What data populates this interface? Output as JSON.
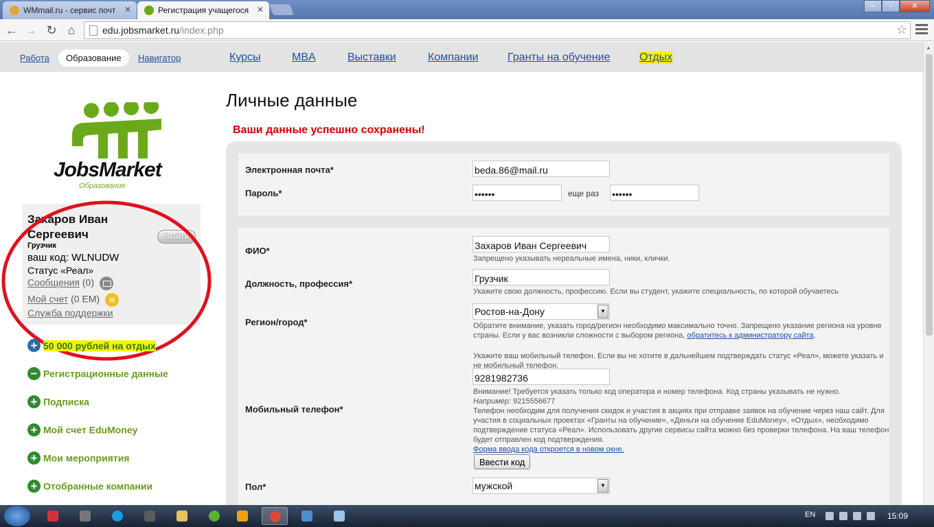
{
  "browser": {
    "tabs": [
      {
        "title": "WMmail.ru - сервис почт",
        "active": false,
        "favicon": "wmmail-icon"
      },
      {
        "title": "Регистрация учащегося",
        "active": true,
        "favicon": "jobsmarket-icon"
      }
    ],
    "url_host": "edu.jobsmarket.ru",
    "url_path": "/index.php"
  },
  "topnav": {
    "sub": [
      "Работа",
      "Образование",
      "Навигатор"
    ],
    "main": [
      "Курсы",
      "MBA",
      "Выставки",
      "Компании",
      "Гранты на обучение",
      "Отдых"
    ]
  },
  "logo": {
    "text": "JobsMarket",
    "sub": "Образование"
  },
  "user": {
    "name": "Захаров Иван Сергеевич",
    "logout": "Выйти",
    "job": "Грузчик",
    "code": "ваш код: WLNUDW",
    "status": "Статус «Реал»",
    "messages_label": "Сообщения",
    "messages_count": "(0)",
    "account_label": "Мой счет",
    "account_value": "(0 ЕМ)",
    "support": "Служба поддержки"
  },
  "sidebar": {
    "items": [
      {
        "label": "50 000 рублей на отдых",
        "icon": "plus-icon"
      },
      {
        "label": "Регистрационные данные",
        "icon": "minus-icon"
      },
      {
        "label": "Подписка",
        "icon": "plus-icon"
      },
      {
        "label": "Мой счет EduMoney",
        "icon": "plus-icon"
      },
      {
        "label": "Мои мероприятия",
        "icon": "plus-icon"
      },
      {
        "label": "Отобранные компании",
        "icon": "plus-icon"
      }
    ]
  },
  "main": {
    "title": "Личные данные",
    "success": "Ваши данные успешно сохранены!"
  },
  "form": {
    "email_label": "Электронная почта*",
    "email_value": "beda.86@mail.ru",
    "password_label": "Пароль*",
    "password_value": "••••••",
    "password_again_label": "еще раз",
    "password_again_value": "••••••",
    "fio_label": "ФИО*",
    "fio_value": "Захаров Иван Сергеевич",
    "fio_hint": "Запрещено указывать нереальные имена, ники, клички.",
    "job_label": "Должность, профессия*",
    "job_value": "Грузчик",
    "job_hint": "Укажите свою должность, профессию. Если вы студент, укажите специальность, по которой обучаетесь",
    "region_label": "Регион/город*",
    "region_value": "Ростов-на-Дону",
    "region_hint": "Обратите внимание, указать город/регион необходимо максимально точно. Запрещено указание региона на уровне страны. Если у вас возникли сложности с выбором региона,",
    "region_hint_link": "обратитесь к администратору сайта",
    "phone_pre_hint": "Укажите ваш мобильный телефон. Если вы не хотите в дальнейшем подтверждать статус «Реал», можете указать и не мобильный телефон.",
    "phone_label": "Мобильный телефон*",
    "phone_value": "9281982736",
    "phone_hint1": "Внимание! Требуется указать только код оператора и номер телефона. Код страны указывать не нужно.",
    "phone_example_label": "Например:",
    "phone_example": "9215556677",
    "phone_hint2": "Телефон необходим для получения скидок и участия в акциях при отправке заявок на обучение через наш сайт. Для участия в социальных проектах «Гранты на обучение», «Деньги на обучение EduMoney», «Отдых», необходимо подтверждение статуса «Реал». Использовать другие сервисы сайта можно без проверки телефона. На ваш телефон будет отправлен код подтверждения.",
    "phone_link": "Форма ввода кода откроется в новом окне.",
    "code_button": "Ввести код",
    "gender_label": "Пол*",
    "gender_value": "мужской"
  },
  "taskbar": {
    "lang": "EN",
    "time": "15:09"
  }
}
